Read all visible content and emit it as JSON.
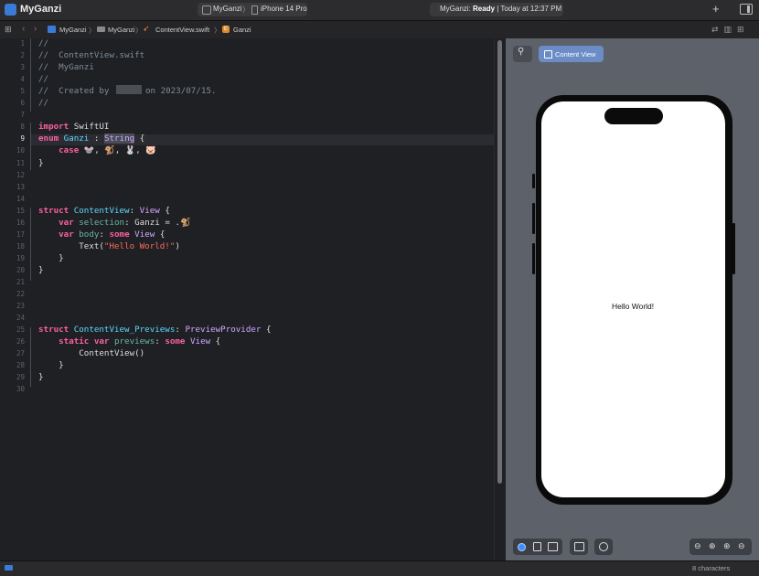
{
  "titlebar": {
    "app_title": "MyGanzi",
    "scheme_app": "MyGanzi",
    "scheme_separator": "〉",
    "scheme_device": "iPhone 14 Pro",
    "status_app": "MyGanzi: ",
    "status_state": "Ready",
    "status_time": " | Today at 12:37 PM",
    "plus_icon": "+"
  },
  "jumpbar": {
    "crumbs": [
      "MyGanzi",
      "MyGanzi",
      "ContentView.swift",
      "Ganzi"
    ],
    "separator": "〉",
    "enum_badge": "E"
  },
  "editor": {
    "line_numbers": [
      "1",
      "2",
      "3",
      "4",
      "5",
      "6",
      "7",
      "8",
      "9",
      "10",
      "11",
      "12",
      "13",
      "14",
      "15",
      "16",
      "17",
      "18",
      "19",
      "20",
      "21",
      "22",
      "23",
      "24",
      "25",
      "26",
      "27",
      "28",
      "29",
      "30"
    ],
    "current_line": 9,
    "lines": {
      "l1": "//",
      "l2": "//  ContentView.swift",
      "l3": "//  MyGanzi",
      "l4": "//",
      "l5a": "//  Created by",
      "l5b": " on 2023/07/15.",
      "l6": "//",
      "l8_kw": "import",
      "l8_rest": " SwiftUI",
      "l9_kw": "enum",
      "l9_name": " Ganzi ",
      "l9_colon": ": ",
      "l9_type": "String",
      "l9_brace": " {",
      "l10_kw": "    case",
      "l10_rest": " 🐭, 🐒, 🐰, 🐷",
      "l11": "}",
      "l15_kw": "struct",
      "l15_name": " ContentView",
      "l15_colon": ": ",
      "l15_type": "View",
      "l15_brace": " {",
      "l16_kw": "    var",
      "l16_prop": " selection",
      "l16_colon": ": ",
      "l16_type": "Ganzi",
      "l16_rest": " = .🐒",
      "l17_kw": "    var",
      "l17_prop": " body",
      "l17_colon": ": ",
      "l17_some": "some",
      "l17_type": " View",
      "l17_brace": " {",
      "l18_fn": "        Text(",
      "l18_str": "\"Hello World!\"",
      "l18_close": ")",
      "l19": "    }",
      "l20": "}",
      "l25_kw": "struct",
      "l25_name": " ContentView_Previews",
      "l25_colon": ": ",
      "l25_type": "PreviewProvider",
      "l25_brace": " {",
      "l26_kw": "    static var",
      "l26_prop": " previews",
      "l26_colon": ": ",
      "l26_some": "some",
      "l26_type": " View",
      "l26_brace": " {",
      "l27": "        ContentView()",
      "l28": "    }",
      "l29": "}"
    }
  },
  "canvas": {
    "content_view_label": "Content View",
    "preview_text": "Hello World!",
    "zoom_icons": [
      "⊖",
      "⊕",
      "⊕",
      "⊖"
    ]
  },
  "statusbar": {
    "char_count": "8 characters"
  },
  "colors": {
    "accent": "#3b7bd8",
    "keyword": "#fc5fa3",
    "type": "#5dd8ff",
    "string": "#fc6a5d",
    "comment": "#7f8c98"
  }
}
